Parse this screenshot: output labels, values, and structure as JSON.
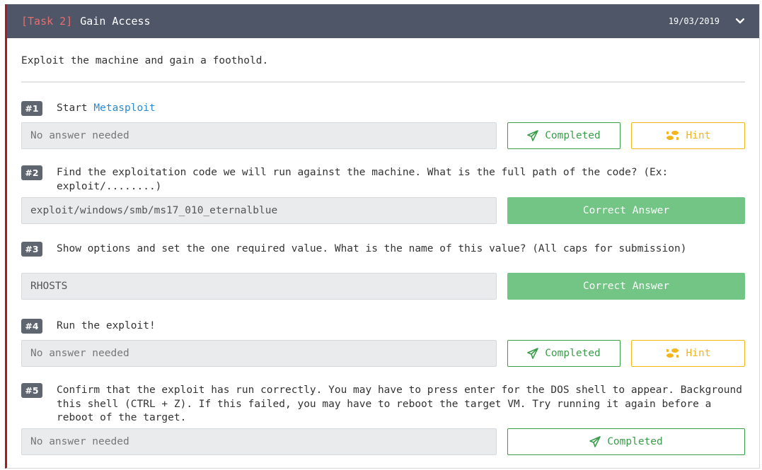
{
  "task": {
    "tag": "[Task 2]",
    "title": "Gain Access",
    "date": "19/03/2019",
    "description": "Exploit the machine and gain a foothold."
  },
  "questions": [
    {
      "number": "#1",
      "text_prefix": "Start ",
      "text_link": "Metasploit",
      "answer": "No answer needed",
      "status": "Completed",
      "hint_label": "Hint"
    },
    {
      "number": "#2",
      "text": "Find the exploitation code we will run against the machine. What is the full path of the code? (Ex: exploit/........)",
      "answer": "exploit/windows/smb/ms17_010_eternalblue",
      "status": "Correct Answer"
    },
    {
      "number": "#3",
      "text": "Show options and set the one required value. What is the name of this value? (All caps for submission)",
      "answer": "RHOSTS",
      "status": "Correct Answer"
    },
    {
      "number": "#4",
      "text": "Run the exploit!",
      "answer": "No answer needed",
      "status": "Completed",
      "hint_label": "Hint"
    },
    {
      "number": "#5",
      "text": "Confirm that the exploit has run correctly. You may have to press enter for the DOS shell to appear. Background this shell (CTRL + Z). If this failed, you may have to reboot the target VM. Try running it again before a reboot of the target.",
      "answer": "No answer needed",
      "status": "Completed"
    }
  ],
  "colors": {
    "header_bg": "#4e5668",
    "accent_border": "#a31d22",
    "task_tag": "#e86e6e",
    "link": "#2a8bd0",
    "completed": "#3a9d4a",
    "hint": "#f3b41c",
    "correct_bg": "#72c585"
  },
  "icons": {
    "collapse": "chevron-down-icon",
    "completed": "paper-plane-icon",
    "hint": "footprints-icon"
  }
}
